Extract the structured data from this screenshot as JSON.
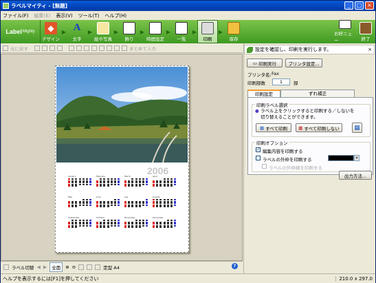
{
  "window": {
    "title": "ラベルマイティ - [無題]"
  },
  "menu": [
    {
      "label": "ファイル(F)",
      "disabled": false
    },
    {
      "label": "編集(E)",
      "disabled": true
    },
    {
      "label": "表示(V)",
      "disabled": false
    },
    {
      "label": "ツール(T)",
      "disabled": false
    },
    {
      "label": "ヘルプ(H)",
      "disabled": false
    }
  ],
  "logo": {
    "main": "Label",
    "sub": "Mighty"
  },
  "steps": [
    "デザイン",
    "文字",
    "絵や写真",
    "飾り",
    "時間設定",
    "一覧",
    "印刷",
    "保存"
  ],
  "right_tools": [
    "お好ニュー",
    "終了"
  ],
  "toolbar2": {
    "undo": "元に戻す",
    "group": "まとめて入力"
  },
  "preview": {
    "year": "2006",
    "months": [
      "January",
      "February",
      "March",
      "April",
      "May",
      "June",
      "July",
      "August",
      "September",
      "October",
      "November",
      "December"
    ]
  },
  "bottom": {
    "label_switch": "ラベル切替",
    "all": "全面",
    "size_type": "定型 A4"
  },
  "status": {
    "help": "ヘルプを表示するには[F1]を押してください",
    "size": "210.0 x 297.0"
  },
  "panel": {
    "header": "設定を確認し、印刷を実行します。",
    "print_button": "印刷実行",
    "printer_settings": "プリンタ設定...",
    "printer_label": "プリンタ名:",
    "printer_name": "Fax",
    "copies_label": "印刷部数",
    "copies_value": "1",
    "copies_unit": "部",
    "tabs": [
      "印刷設定",
      "ずれ補正"
    ],
    "select_group": "印刷ラベル選択",
    "select_desc": "ラベル上をクリックすると印刷する／しないを切り替えることができます。",
    "print_all": "すべて印刷",
    "print_none": "すべて印刷しない",
    "options_group": "印刷オプション",
    "opt_edit": "編集内容を印刷する",
    "opt_frame": "ラベルの外枠を印刷する",
    "opt_outline": "ラベルの外枠線を印刷する",
    "output_method": "出力方法..."
  }
}
